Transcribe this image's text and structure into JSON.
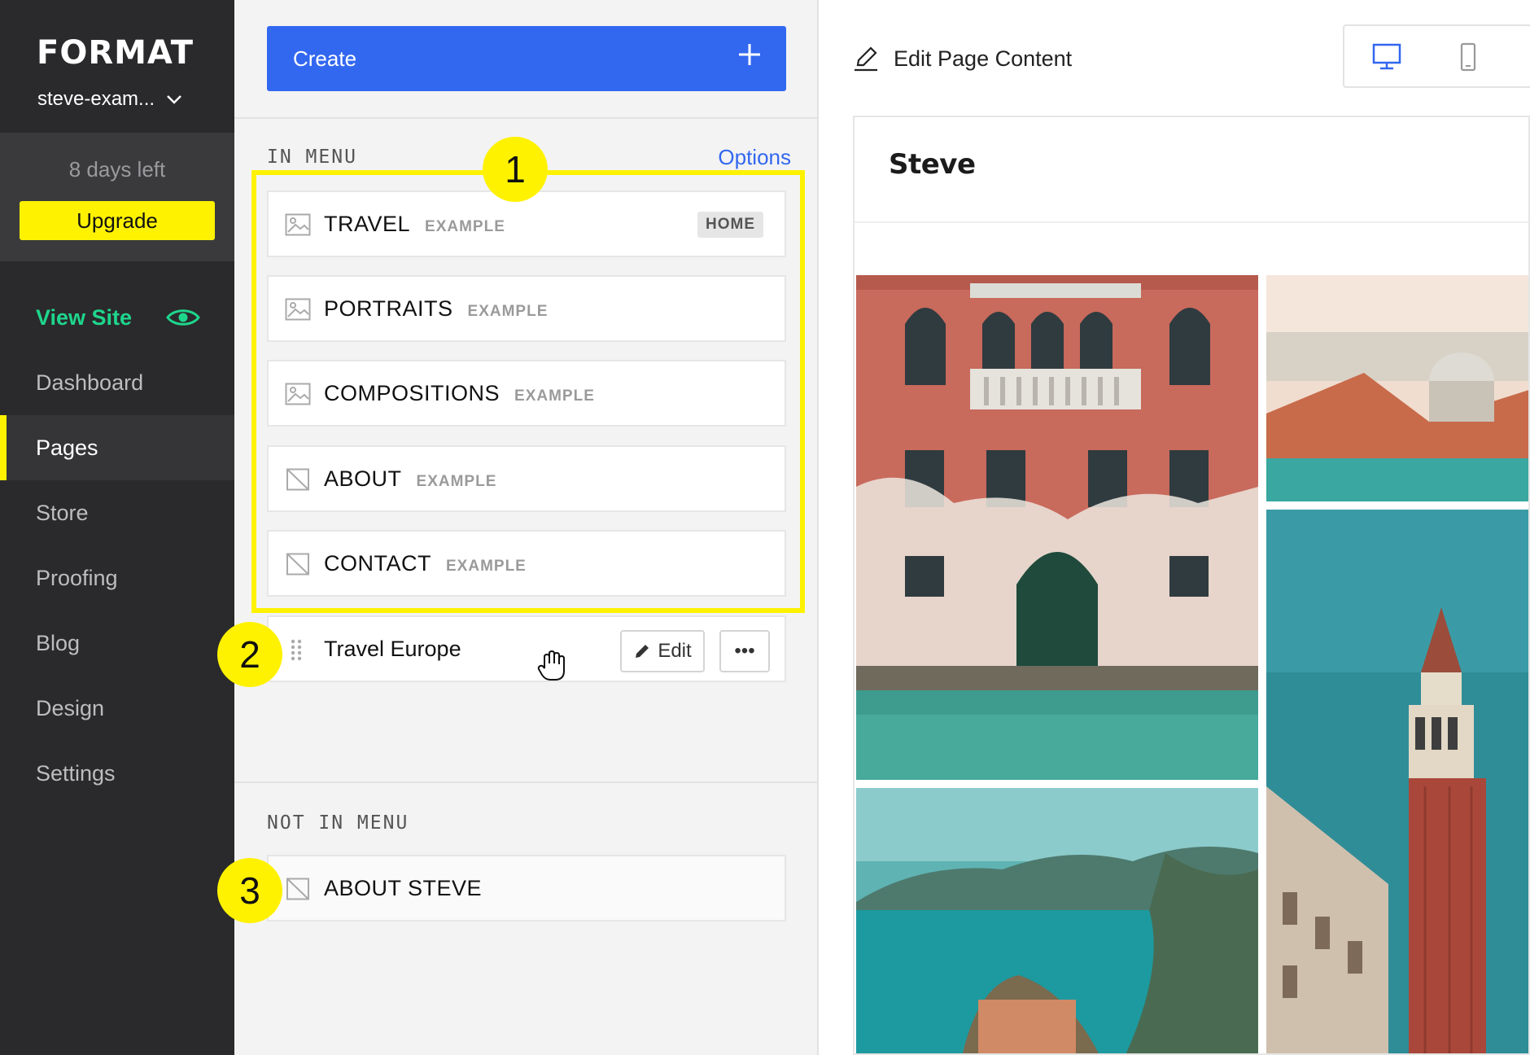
{
  "sidebar": {
    "brand": "FORMAT",
    "site_name": "steve-exam...",
    "trial": {
      "days_left": "8 days left",
      "upgrade_label": "Upgrade"
    },
    "view_site": "View Site",
    "nav": [
      {
        "label": "Dashboard"
      },
      {
        "label": "Pages",
        "active": true
      },
      {
        "label": "Store"
      },
      {
        "label": "Proofing"
      },
      {
        "label": "Blog"
      },
      {
        "label": "Design"
      },
      {
        "label": "Settings"
      }
    ]
  },
  "pages": {
    "create_label": "Create",
    "in_menu_label": "IN MENU",
    "options_label": "Options",
    "in_menu": [
      {
        "title": "TRAVEL",
        "tag": "EXAMPLE",
        "badge": "HOME",
        "icon": "gallery-icon"
      },
      {
        "title": "PORTRAITS",
        "tag": "EXAMPLE",
        "icon": "gallery-icon"
      },
      {
        "title": "COMPOSITIONS",
        "tag": "EXAMPLE",
        "icon": "gallery-icon"
      },
      {
        "title": "ABOUT",
        "tag": "EXAMPLE",
        "icon": "text-page-icon"
      },
      {
        "title": "CONTACT",
        "tag": "EXAMPLE",
        "icon": "text-page-icon"
      }
    ],
    "dragging_item": {
      "title": "Travel Europe",
      "edit_label": "Edit",
      "more_label": "•••"
    },
    "not_in_menu_label": "NOT IN MENU",
    "not_in_menu": [
      {
        "title": "ABOUT STEVE",
        "icon": "text-page-icon"
      }
    ]
  },
  "callouts": [
    "1",
    "2",
    "3"
  ],
  "preview": {
    "edit_page_content": "Edit Page Content",
    "device_options": [
      "desktop-icon",
      "mobile-icon"
    ],
    "site_title": "Steve"
  },
  "colors": {
    "accent_blue": "#3267f0",
    "highlight_yellow": "#fff200",
    "view_site_green": "#1ed58c",
    "sidebar_bg": "#2a2a2c"
  }
}
